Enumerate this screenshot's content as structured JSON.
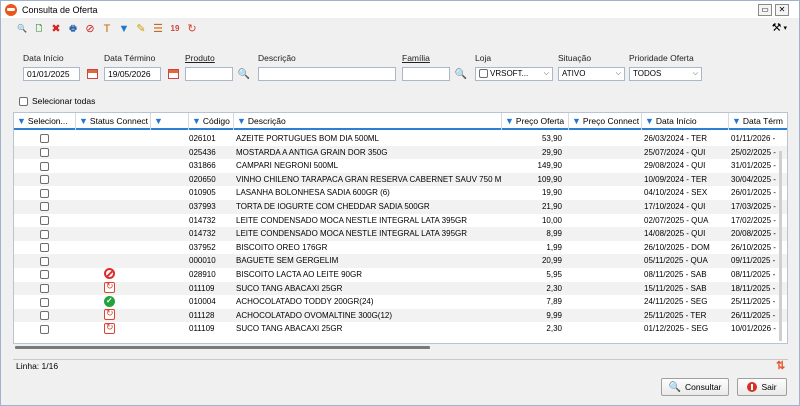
{
  "window": {
    "title": "Consulta de Oferta",
    "minimize_glyph": "▭",
    "close_glyph": "✕"
  },
  "toolbar": {
    "icons": [
      {
        "name": "consult-icon",
        "glyph": "🔍",
        "color": "#1d5ea8"
      },
      {
        "name": "new-doc-icon",
        "glyph": "🗋",
        "color": "#2a8b2a"
      },
      {
        "name": "delete-icon",
        "glyph": "✖",
        "color": "#d42020"
      },
      {
        "name": "print-icon",
        "glyph": "🖶",
        "color": "#2b62a9"
      },
      {
        "name": "cancel-icon",
        "glyph": "⊘",
        "color": "#d42020"
      },
      {
        "name": "text-format-icon",
        "glyph": "T",
        "color": "#cc6600"
      },
      {
        "name": "filter-icon",
        "glyph": "▼",
        "color": "#1e78d2"
      },
      {
        "name": "edit-icon",
        "glyph": "✎",
        "color": "#d19a00"
      },
      {
        "name": "list-icon",
        "glyph": "☰",
        "color": "#c46a1a"
      },
      {
        "name": "calendar-icon",
        "glyph": "19",
        "color": "#c44"
      },
      {
        "name": "sync-icon",
        "glyph": "↻",
        "color": "#d9432f"
      }
    ],
    "tools_glyph": "⚒",
    "tools_arrow": "▾"
  },
  "filters": {
    "data_inicio": {
      "label": "Data Início",
      "value": "01/01/2025"
    },
    "data_termino": {
      "label": "Data Término",
      "value": "19/05/2026"
    },
    "produto": {
      "label": "Produto",
      "value": ""
    },
    "descricao": {
      "label": "Descrição",
      "value": ""
    },
    "familia": {
      "label": "Família",
      "value": ""
    },
    "loja": {
      "label": "Loja",
      "value": "VRSOFT..."
    },
    "situacao": {
      "label": "Situação",
      "value": "ATIVO"
    },
    "prioridade": {
      "label": "Prioridade Oferta",
      "value": "TODOS"
    }
  },
  "select_all": {
    "label": "Selecionar todas"
  },
  "grid": {
    "columns": [
      "Selecion...",
      "Status Connect",
      "",
      "Código",
      "Descrição",
      "Preço Oferta",
      "Preço Connect",
      "Data Início",
      "Data Térm"
    ],
    "rows": [
      {
        "status": "",
        "codigo": "026101",
        "descricao": "AZEITE PORTUGUES BOM DIA 500ML",
        "preco": "53,90",
        "inicio": "26/03/2024 - TER",
        "termino": "01/11/2026 -"
      },
      {
        "status": "",
        "codigo": "025436",
        "descricao": "MOSTARDA A ANTIGA GRAIN DOR 350G",
        "preco": "29,90",
        "inicio": "25/07/2024 - QUI",
        "termino": "25/02/2025 -"
      },
      {
        "status": "",
        "codigo": "031866",
        "descricao": "CAMPARI NEGRONI 500ML",
        "preco": "149,90",
        "inicio": "29/08/2024 - QUI",
        "termino": "31/01/2025 -"
      },
      {
        "status": "",
        "codigo": "020650",
        "descricao": "VINHO CHILENO TARAPACA GRAN RESERVA CABERNET SAUV 750 ML",
        "preco": "109,90",
        "inicio": "10/09/2024 - TER",
        "termino": "30/04/2025 -"
      },
      {
        "status": "",
        "codigo": "010905",
        "descricao": "LASANHA BOLONHESA SADIA 600GR (6)",
        "preco": "19,90",
        "inicio": "04/10/2024 - SEX",
        "termino": "26/01/2025 -"
      },
      {
        "status": "",
        "codigo": "037993",
        "descricao": "TORTA DE IOGURTE COM CHEDDAR SADIA  500GR",
        "preco": "21,90",
        "inicio": "17/10/2024 - QUI",
        "termino": "17/03/2025 -"
      },
      {
        "status": "",
        "codigo": "014732",
        "descricao": "LEITE CONDENSADO MOCA NESTLE INTEGRAL LATA 395GR",
        "preco": "10,00",
        "inicio": "02/07/2025 - QUA",
        "termino": "17/02/2025 -"
      },
      {
        "status": "",
        "codigo": "014732",
        "descricao": "LEITE CONDENSADO MOCA NESTLE INTEGRAL LATA 395GR",
        "preco": "8,99",
        "inicio": "14/08/2025 - QUI",
        "termino": "20/08/2025 -"
      },
      {
        "status": "",
        "codigo": "037952",
        "descricao": "BISCOITO OREO 176GR",
        "preco": "1,99",
        "inicio": "26/10/2025 - DOM",
        "termino": "26/10/2025 -"
      },
      {
        "status": "",
        "codigo": "000010",
        "descricao": "BAGUETE SEM GERGELIM",
        "preco": "20,99",
        "inicio": "05/11/2025 - QUA",
        "termino": "09/11/2025 -"
      },
      {
        "status": "blocked",
        "codigo": "028910",
        "descricao": "BISCOITO LACTA AO LEITE 90GR",
        "preco": "5,95",
        "inicio": "08/11/2025 - SAB",
        "termino": "08/11/2025 -"
      },
      {
        "status": "sync",
        "codigo": "011109",
        "descricao": "SUCO TANG ABACAXI 25GR",
        "preco": "2,30",
        "inicio": "15/11/2025 - SAB",
        "termino": "18/11/2025 -"
      },
      {
        "status": "ok",
        "codigo": "010004",
        "descricao": "ACHOCOLATADO TODDY 200GR(24)",
        "preco": "7,89",
        "inicio": "24/11/2025 - SEG",
        "termino": "25/11/2025 -"
      },
      {
        "status": "sync",
        "codigo": "011128",
        "descricao": "ACHOCOLATADO OVOMALTINE 300G(12)",
        "preco": "9,99",
        "inicio": "25/11/2025 - TER",
        "termino": "26/11/2025 -"
      },
      {
        "status": "sync",
        "codigo": "011109",
        "descricao": "SUCO TANG ABACAXI 25GR",
        "preco": "2,30",
        "inicio": "01/12/2025 - SEG",
        "termino": "10/01/2026 -"
      }
    ]
  },
  "status_bar": {
    "text": "Linha: 1/16"
  },
  "buttons": {
    "consultar": "Consultar",
    "sair": "Sair"
  },
  "colors": {
    "filter_accent": "#1e78d2",
    "header_underline": "#2c7fd3",
    "exit": "#d9301f"
  }
}
